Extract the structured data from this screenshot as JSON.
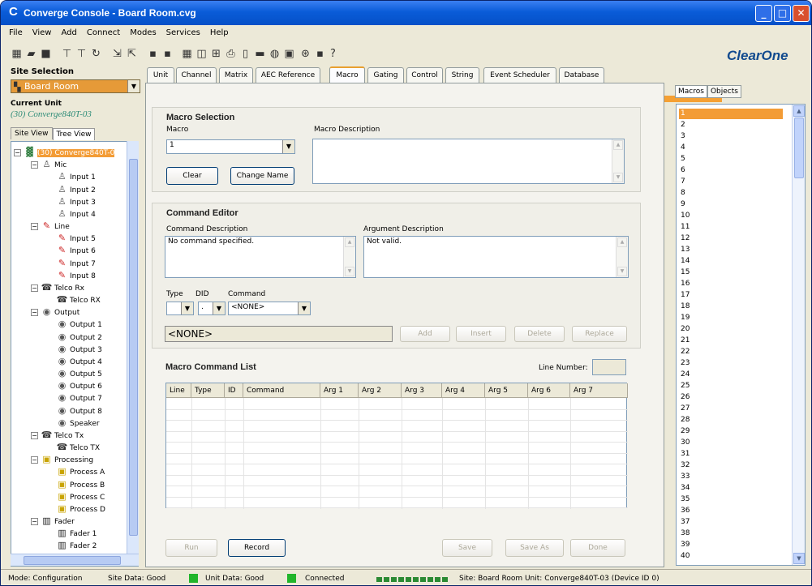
{
  "window": {
    "title": "Converge Console - Board Room.cvg"
  },
  "menu": [
    "File",
    "View",
    "Add",
    "Connect",
    "Modes",
    "Services",
    "Help"
  ],
  "brand": "ClearOne",
  "site_selection": {
    "label": "Site Selection",
    "value": "Board Room"
  },
  "current_unit": {
    "label": "Current Unit",
    "value": "(30) Converge840T-03"
  },
  "left_tabs": [
    "Site View",
    "Tree View"
  ],
  "tree": [
    {
      "label": "(30) Converge840T-0",
      "level": 0,
      "icon": "unit-icon",
      "expander": "−",
      "selected": true
    },
    {
      "label": "Mic",
      "level": 1,
      "icon": "mic-icon",
      "expander": "−"
    },
    {
      "label": "Input 1",
      "level": 2,
      "icon": "mic-icon"
    },
    {
      "label": "Input 2",
      "level": 2,
      "icon": "mic-icon"
    },
    {
      "label": "Input 3",
      "level": 2,
      "icon": "mic-icon"
    },
    {
      "label": "Input 4",
      "level": 2,
      "icon": "mic-icon"
    },
    {
      "label": "Line",
      "level": 1,
      "icon": "line-icon",
      "expander": "−"
    },
    {
      "label": "Input 5",
      "level": 2,
      "icon": "line-icon"
    },
    {
      "label": "Input 6",
      "level": 2,
      "icon": "line-icon"
    },
    {
      "label": "Input 7",
      "level": 2,
      "icon": "line-icon"
    },
    {
      "label": "Input 8",
      "level": 2,
      "icon": "line-icon"
    },
    {
      "label": "Telco Rx",
      "level": 1,
      "icon": "telco-icon",
      "expander": "−"
    },
    {
      "label": "Telco RX",
      "level": 2,
      "icon": "telco-icon"
    },
    {
      "label": "Output",
      "level": 1,
      "icon": "speaker-icon",
      "expander": "−"
    },
    {
      "label": "Output 1",
      "level": 2,
      "icon": "speaker-icon"
    },
    {
      "label": "Output 2",
      "level": 2,
      "icon": "speaker-icon"
    },
    {
      "label": "Output 3",
      "level": 2,
      "icon": "speaker-icon"
    },
    {
      "label": "Output 4",
      "level": 2,
      "icon": "speaker-icon"
    },
    {
      "label": "Output 5",
      "level": 2,
      "icon": "speaker-icon"
    },
    {
      "label": "Output 6",
      "level": 2,
      "icon": "speaker-icon"
    },
    {
      "label": "Output 7",
      "level": 2,
      "icon": "speaker-icon"
    },
    {
      "label": "Output 8",
      "level": 2,
      "icon": "speaker-icon"
    },
    {
      "label": "Speaker",
      "level": 2,
      "icon": "speaker-icon"
    },
    {
      "label": "Telco Tx",
      "level": 1,
      "icon": "telco-icon",
      "expander": "−"
    },
    {
      "label": "Telco TX",
      "level": 2,
      "icon": "telco-icon"
    },
    {
      "label": "Processing",
      "level": 1,
      "icon": "process-icon",
      "expander": "−"
    },
    {
      "label": "Process A",
      "level": 2,
      "icon": "process-icon"
    },
    {
      "label": "Process B",
      "level": 2,
      "icon": "process-icon"
    },
    {
      "label": "Process C",
      "level": 2,
      "icon": "process-icon"
    },
    {
      "label": "Process D",
      "level": 2,
      "icon": "process-icon"
    },
    {
      "label": "Fader",
      "level": 1,
      "icon": "fader-icon",
      "expander": "−"
    },
    {
      "label": "Fader 1",
      "level": 2,
      "icon": "fader-icon"
    },
    {
      "label": "Fader 2",
      "level": 2,
      "icon": "fader-icon"
    }
  ],
  "tabs": [
    "Unit",
    "Channel",
    "Matrix",
    "AEC Reference",
    "Macro",
    "Gating",
    "Control",
    "String",
    "Event Scheduler",
    "Database"
  ],
  "active_tab": "Macro",
  "macro_selection": {
    "title": "Macro Selection",
    "macro_label": "Macro",
    "macro_value": "1",
    "description_label": "Macro Description",
    "description_value": "",
    "clear": "Clear",
    "change_name": "Change Name"
  },
  "command_editor": {
    "title": "Command Editor",
    "command_desc_label": "Command Description",
    "command_desc_value": "No command specified.",
    "arg_desc_label": "Argument Description",
    "arg_desc_value": "Not valid.",
    "type_label": "Type",
    "did_label": "DID",
    "command_label": "Command",
    "type_value": "",
    "did_value": ".",
    "command_value": "<NONE>",
    "command_display": "<NONE>",
    "add": "Add",
    "insert": "Insert",
    "delete": "Delete",
    "replace": "Replace"
  },
  "command_list": {
    "title": "Macro Command List",
    "line_number_label": "Line Number:",
    "line_number_value": "",
    "columns": [
      "Line",
      "Type",
      "ID",
      "Command",
      "Arg 1",
      "Arg 2",
      "Arg 3",
      "Arg 4",
      "Arg 5",
      "Arg 6",
      "Arg 7"
    ],
    "run": "Run",
    "record": "Record",
    "save": "Save",
    "save_as": "Save As",
    "done": "Done"
  },
  "right_tabs": [
    "Macros",
    "Objects"
  ],
  "macros": [
    "1",
    "2",
    "3",
    "4",
    "5",
    "6",
    "7",
    "8",
    "9",
    "10",
    "11",
    "12",
    "13",
    "14",
    "15",
    "16",
    "17",
    "18",
    "19",
    "20",
    "21",
    "22",
    "23",
    "24",
    "25",
    "26",
    "27",
    "28",
    "29",
    "30",
    "31",
    "32",
    "33",
    "34",
    "35",
    "36",
    "37",
    "38",
    "39",
    "40"
  ],
  "selected_macro": "1",
  "status": {
    "mode": "Mode: Configuration",
    "site_data": "Site Data: Good",
    "unit_data": "Unit Data: Good",
    "connected": "Connected",
    "site_info": "Site: Board Room    Unit: Converge840T-03 (Device ID 0)"
  },
  "colors": {
    "accent": "#f39c36",
    "brand": "#114a8e",
    "status_ok": "#21b52b"
  }
}
